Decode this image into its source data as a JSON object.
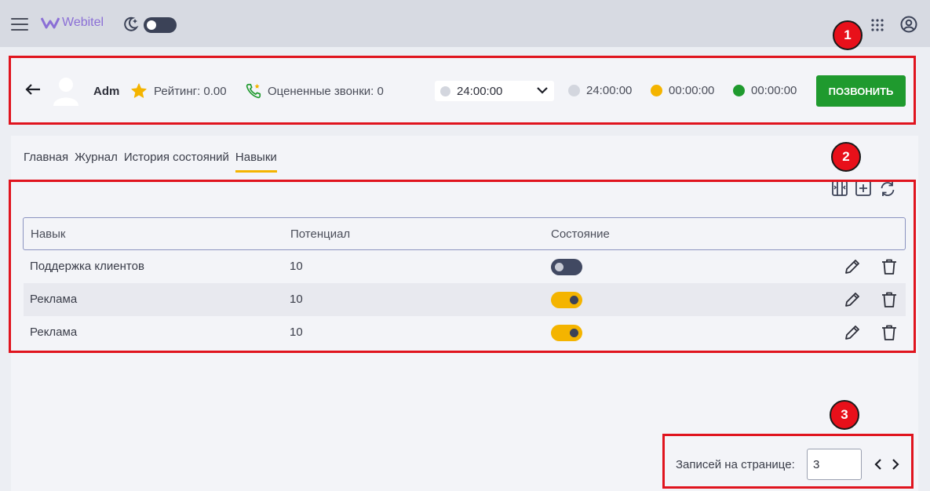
{
  "header": {
    "logo_text": "Webitel",
    "icons": [
      "menu-icon",
      "webitel-logo-icon",
      "moon-icon",
      "apps-grid-icon",
      "account-icon"
    ]
  },
  "agent": {
    "name": "Adm",
    "rating": "Рейтинг: 0.00",
    "rated_calls": "Оцененные звонки: 0",
    "status_value": "24:00:00",
    "stats": [
      {
        "value": "24:00:00",
        "color": "#d3d6de"
      },
      {
        "value": "00:00:00",
        "color": "#f4b400"
      },
      {
        "value": "00:00:00",
        "color": "#1f9a2e"
      }
    ],
    "call_button": "ПОЗВОНИТЬ"
  },
  "tabs": [
    {
      "label": "Главная",
      "active": false
    },
    {
      "label": "Журнал",
      "active": false
    },
    {
      "label": "История состояний",
      "active": false
    },
    {
      "label": "Навыки",
      "active": true
    }
  ],
  "table": {
    "columns": [
      "Навык",
      "Потенциал",
      "Состояние"
    ],
    "rows": [
      {
        "skill": "Поддержка клиентов",
        "capacity": "10",
        "enabled": false
      },
      {
        "skill": "Реклама",
        "capacity": "10",
        "enabled": true
      },
      {
        "skill": "Реклама",
        "capacity": "10",
        "enabled": true
      }
    ]
  },
  "pagination": {
    "label": "Записей на странице:",
    "per_page": "3"
  },
  "annotations": [
    "1",
    "2",
    "3"
  ],
  "colors": {
    "accent": "#f4b400",
    "call_button": "#1f9a2e",
    "highlight": "#e0141e",
    "logo": "#8b6fd6"
  }
}
